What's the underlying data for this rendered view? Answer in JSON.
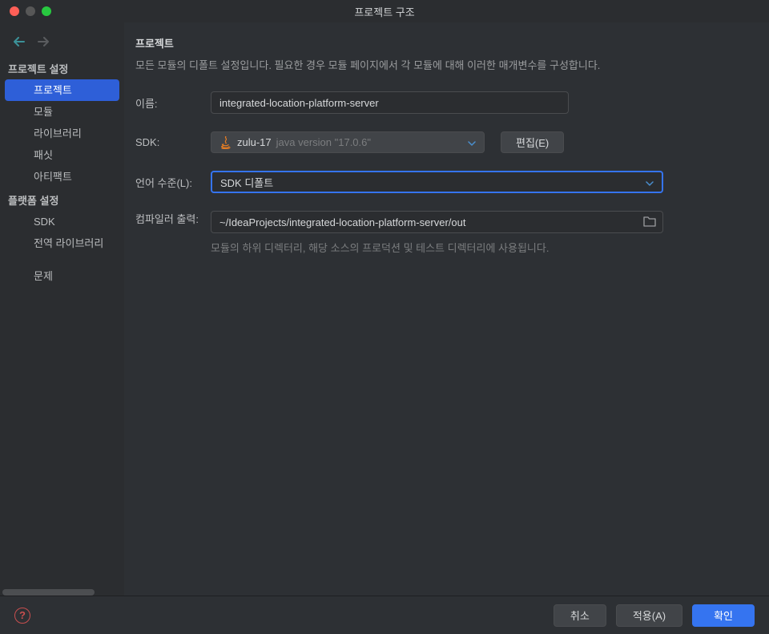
{
  "window": {
    "title": "프로젝트 구조"
  },
  "sidebar": {
    "section1": {
      "header": "프로젝트 설정",
      "items": [
        {
          "label": "프로젝트"
        },
        {
          "label": "모듈"
        },
        {
          "label": "라이브러리"
        },
        {
          "label": "패싯"
        },
        {
          "label": "아티팩트"
        }
      ]
    },
    "section2": {
      "header": "플랫폼 설정",
      "items": [
        {
          "label": "SDK"
        },
        {
          "label": "전역 라이브러리"
        }
      ]
    },
    "section3": {
      "items": [
        {
          "label": "문제"
        }
      ]
    }
  },
  "main": {
    "title": "프로젝트",
    "subtitle": "모든 모듈의 디폴트 설정입니다. 필요한 경우 모듈 페이지에서 각 모듈에 대해 이러한 매개변수를 구성합니다.",
    "nameLabel": "이름:",
    "nameValue": "integrated-location-platform-server",
    "sdkLabel": "SDK:",
    "sdkName": "zulu-17",
    "sdkVersion": "java version \"17.0.6\"",
    "editButton": "편집(E)",
    "langLabel": "언어 수준(L):",
    "langValue": "SDK 디폴트",
    "compilerLabel": "컴파일러 출력:",
    "compilerValue": "~/IdeaProjects/integrated-location-platform-server/out",
    "compilerHint": "모듈의 하위 디렉터리, 해당 소스의 프로덕션 및 테스트 디렉터리에 사용됩니다."
  },
  "footer": {
    "cancel": "취소",
    "apply": "적용(A)",
    "ok": "확인"
  }
}
